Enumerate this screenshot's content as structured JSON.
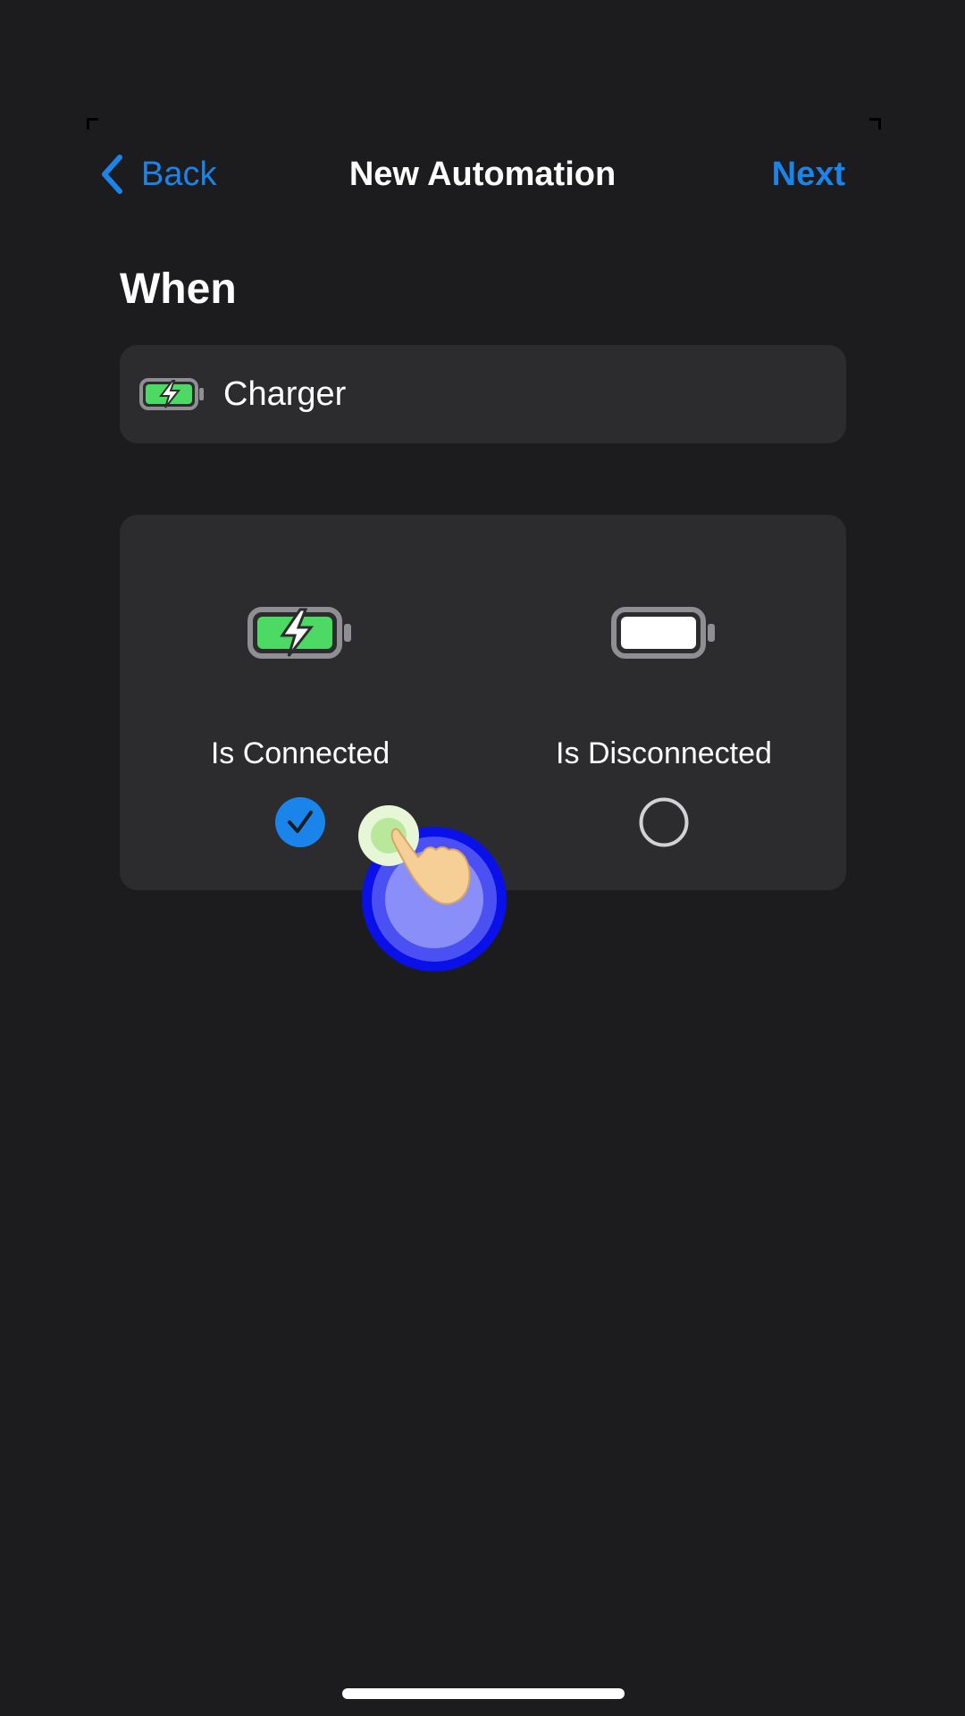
{
  "nav": {
    "back_label": "Back",
    "title": "New Automation",
    "next_label": "Next"
  },
  "section": {
    "title": "When"
  },
  "trigger": {
    "label": "Charger",
    "icon": "battery-charging-icon"
  },
  "options": [
    {
      "label": "Is Connected",
      "icon": "battery-charging-icon",
      "selected": true
    },
    {
      "label": "Is Disconnected",
      "icon": "battery-full-icon",
      "selected": false
    }
  ],
  "colors": {
    "background": "#1c1c1e",
    "card": "#2c2c2e",
    "accent": "#1b84ea",
    "battery_green": "#4cd964",
    "touch_blue": "#0a10e8"
  }
}
